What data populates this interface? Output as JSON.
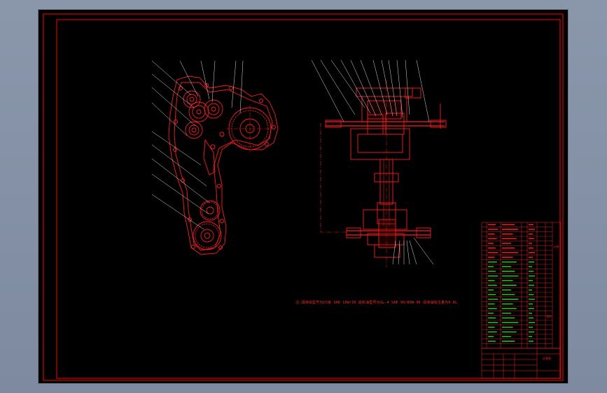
{
  "drawing": {
    "note": "注:润滑油型号为CC级 SAE 10W/30 齿轮油型号为GL-4 SAE 90/80W-90 润滑油加注量为0.6L",
    "title_block": {
      "drawing_name": "总装图",
      "scale_label": "比例",
      "sheet_label": "图号"
    },
    "colors": {
      "frame": "#ff0000",
      "geometry": "#ff1a1a",
      "leader": "#e0e0e0",
      "table_green": "#18d418",
      "table_red": "#ff2020",
      "sheet_bg": "#000000"
    }
  }
}
